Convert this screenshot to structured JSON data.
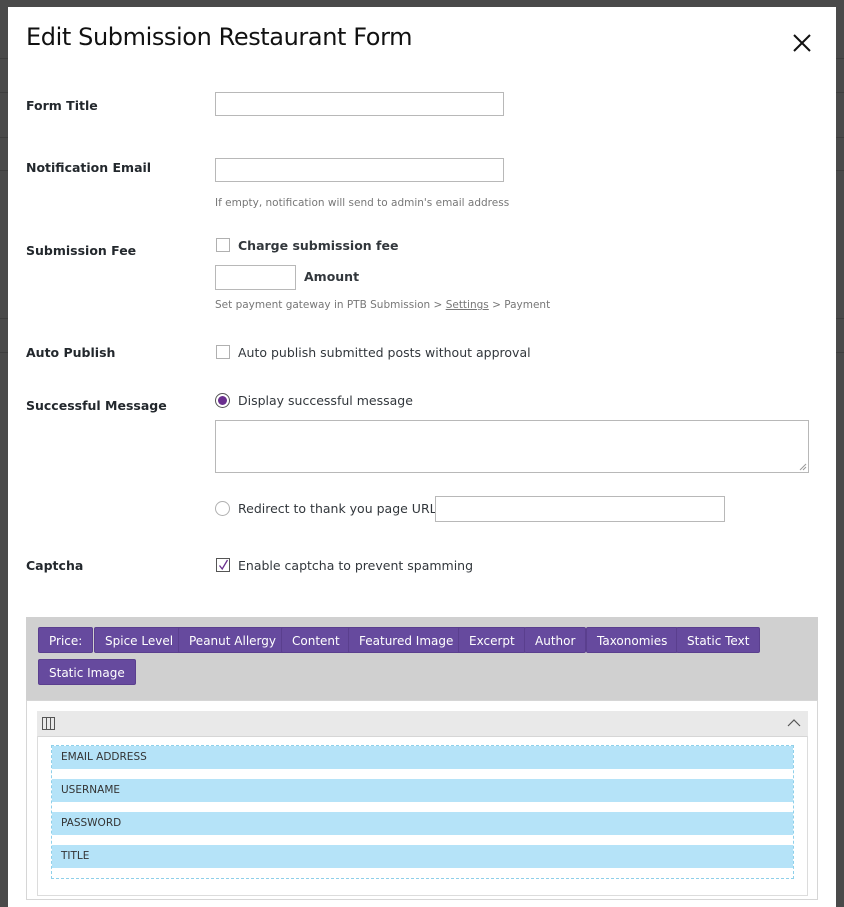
{
  "modal": {
    "title": "Edit Submission Restaurant Form",
    "close_icon": "close-icon"
  },
  "form_title": {
    "label": "Form Title",
    "value": ""
  },
  "notification_email": {
    "label": "Notification Email",
    "value": "",
    "help": "If empty, notification will send to admin's email address"
  },
  "submission_fee": {
    "label": "Submission Fee",
    "charge_label": "Charge submission fee",
    "charge_checked": false,
    "amount_value": "",
    "amount_label": "Amount",
    "help_prefix": "Set payment gateway in PTB Submission > ",
    "help_link": "Settings",
    "help_suffix": " > Payment"
  },
  "auto_publish": {
    "label": "Auto Publish",
    "option_label": "Auto publish submitted posts without approval",
    "checked": false
  },
  "successful_message": {
    "label": "Successful Message",
    "display_option_label": "Display successful message",
    "display_selected": true,
    "message_value": "",
    "redirect_option_label": "Redirect to thank you page URL:",
    "redirect_selected": false,
    "redirect_url_value": ""
  },
  "captcha": {
    "label": "Captcha",
    "option_label": "Enable captcha to prevent spamming",
    "checked": true
  },
  "field_buttons": [
    "Price:",
    "Spice Level",
    "Peanut Allergy",
    "Content",
    "Featured Image",
    "Excerpt",
    "Author",
    "Taxonomies",
    "Static Text",
    "Static Image"
  ],
  "layout": {
    "columns_icon": "columns-icon",
    "collapse_icon": "chevron-up-icon",
    "fields": [
      "EMAIL ADDRESS",
      "USERNAME",
      "PASSWORD",
      "TITLE"
    ]
  },
  "colors": {
    "accent": "#664a9e",
    "field_row": "#b5e3f8",
    "overlay": "#4a4a4a"
  }
}
